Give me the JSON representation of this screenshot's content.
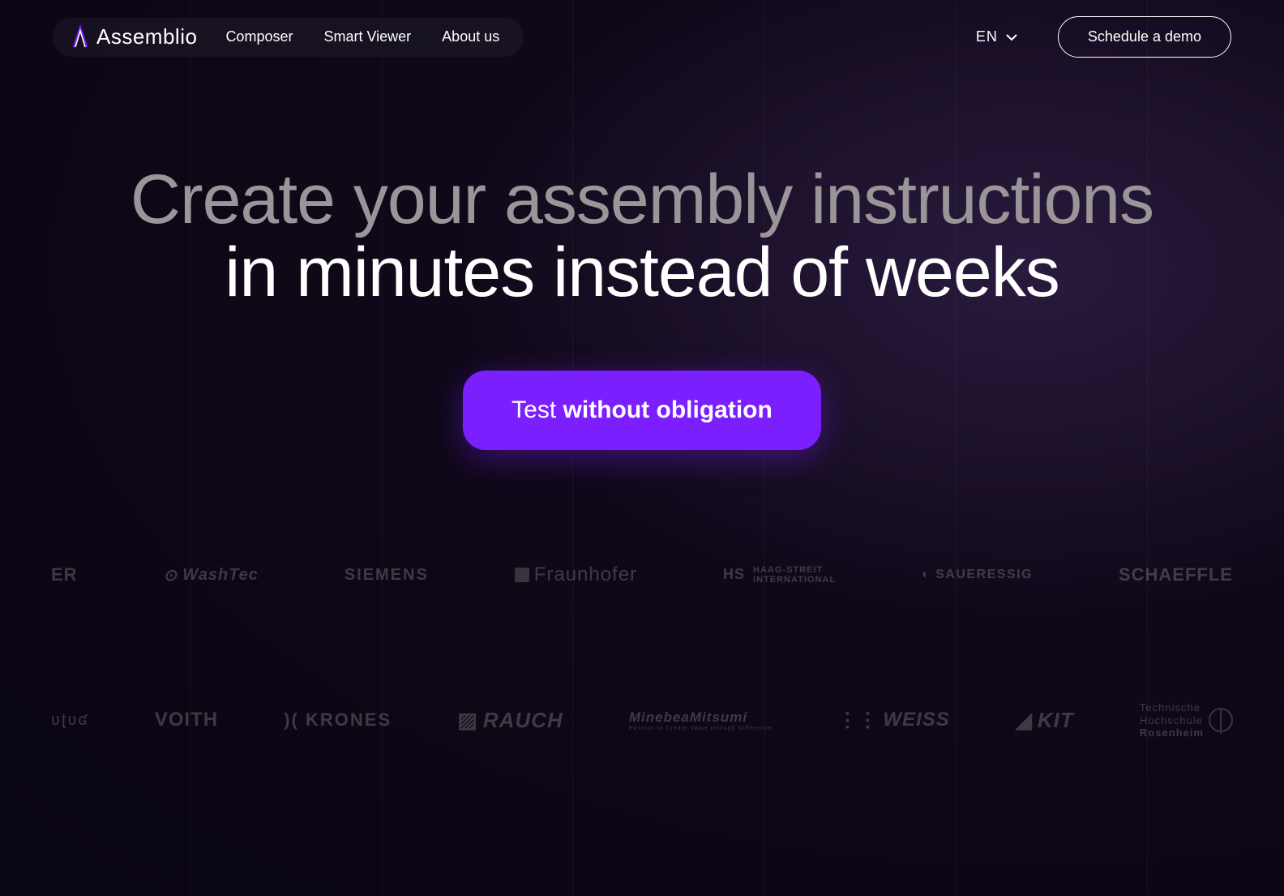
{
  "brand": {
    "name": "Assemblio"
  },
  "nav": {
    "links": [
      {
        "label": "Composer"
      },
      {
        "label": "Smart Viewer"
      },
      {
        "label": "About us"
      }
    ]
  },
  "header": {
    "language": "EN",
    "schedule_label": "Schedule a demo"
  },
  "hero": {
    "title_line1": "Create your assembly instructions",
    "title_line2": "in minutes instead of weeks",
    "cta_light": "Test ",
    "cta_bold": "without obligation"
  },
  "logos_row1": [
    {
      "name": "ER",
      "class": "logo-er"
    },
    {
      "name": "WashTec",
      "class": "logo-washtec",
      "prefix_icon": "circle-swirl"
    },
    {
      "name": "SIEMENS",
      "class": "logo-siemens"
    },
    {
      "name": "Fraunhofer",
      "class": "logo-fraunhofer",
      "prefix_icon": "square"
    },
    {
      "name": "HAAG-STREIT",
      "sub": "INTERNATIONAL",
      "class": "logo-haag",
      "prefix_icon": "hs"
    },
    {
      "name": "SAUERESSIG",
      "class": "logo-saueressig",
      "prefix_icon": "s-circle"
    },
    {
      "name": "SCHAEFFLE",
      "class": "logo-schaeffle"
    }
  ],
  "logos_row2": [
    {
      "name": "ʋʈʋʛ",
      "class": "logo-ulus"
    },
    {
      "name": "VOITH",
      "class": "logo-voith"
    },
    {
      "name": ")( KRONES",
      "class": "logo-krones"
    },
    {
      "name": "RAUCH",
      "class": "logo-rauch",
      "prefix_icon": "square-slash"
    },
    {
      "name": "MinebeaMitsumi",
      "sub": "Passion to Create Value through Difference",
      "class": "logo-minebea"
    },
    {
      "name": "WEISS",
      "class": "logo-weiss",
      "prefix_icon": "dots"
    },
    {
      "name": "KIT",
      "class": "logo-kit",
      "prefix_icon": "fan"
    },
    {
      "name_line1": "Technische",
      "name_line2": "Hochschule",
      "name_line3": "Rosenheim",
      "class": "logo-rosenheim",
      "suffix_icon": "circle-cross"
    }
  ]
}
